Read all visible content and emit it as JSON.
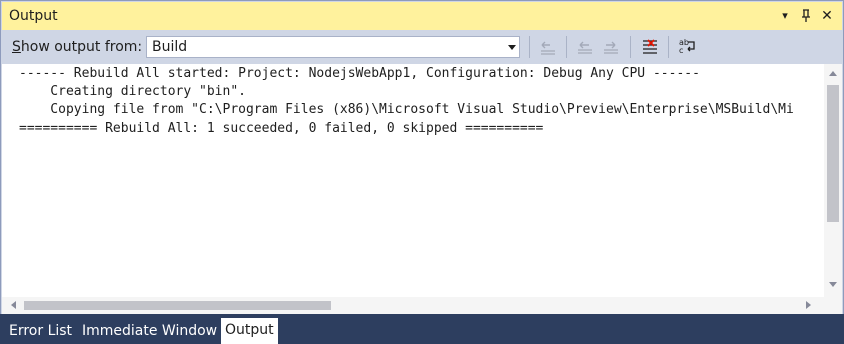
{
  "window": {
    "title": "Output",
    "buttons": {
      "dropdown": "▾",
      "pin": "⊥",
      "close": "✕"
    }
  },
  "toolbar": {
    "show_output_prefix": "S",
    "show_output_rest": "how output from:",
    "source_value": "Build",
    "tools": [
      "go-to-previous-message-icon",
      "find-previous-icon",
      "find-next-icon",
      "clear-all-icon",
      "toggle-word-wrap-icon"
    ]
  },
  "output": {
    "lines": [
      "------ Rebuild All started: Project: NodejsWebApp1, Configuration: Debug Any CPU ------",
      "    Creating directory \"bin\".",
      "    Copying file from \"C:\\Program Files (x86)\\Microsoft Visual Studio\\Preview\\Enterprise\\MSBuild\\Mi",
      "========== Rebuild All: 1 succeeded, 0 failed, 0 skipped =========="
    ]
  },
  "tabs": [
    {
      "label": "Error List",
      "active": false
    },
    {
      "label": "Immediate Window",
      "active": false
    },
    {
      "label": "Output",
      "active": true
    }
  ],
  "colors": {
    "titlebar_bg": "#fff29d",
    "tabbar_bg": "#2d3e5f",
    "toolbar_bg": "#cfd6e5"
  }
}
